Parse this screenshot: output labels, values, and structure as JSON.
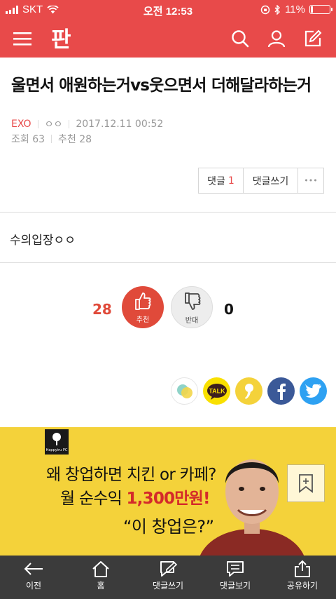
{
  "status": {
    "carrier": "SKT",
    "time": "오전 12:53",
    "battery": "11%"
  },
  "header": {
    "logo_text": "판"
  },
  "post": {
    "title": "울면서 애원하는거vs웃으면서 더해달라하는거",
    "category": "EXO",
    "author": "ㅇㅇ",
    "date": "2017.12.11 00:52",
    "views": "조회 63",
    "recommends": "추천 28",
    "body": "수의입장ㅇㅇ"
  },
  "comment_buttons": {
    "comments_label": "댓글",
    "comments_count": "1",
    "write_label": "댓글쓰기",
    "more_label": "•••"
  },
  "votes": {
    "up_count": "28",
    "up_label": "추천",
    "down_label": "반대",
    "down_count": "0"
  },
  "share": {
    "talk_label": "TALK"
  },
  "ad": {
    "line1": "왜 창업하면 치킨 or 카페?",
    "line2_prefix": "월 순수익 ",
    "line2_highlight": "1,300만원!",
    "line3": "“이 창업은?”",
    "brand": "Happyiru PC"
  },
  "toolbar": {
    "items": [
      {
        "label": "이전",
        "icon": "back-arrow-icon"
      },
      {
        "label": "홈",
        "icon": "home-icon"
      },
      {
        "label": "댓글쓰기",
        "icon": "write-comment-icon"
      },
      {
        "label": "댓글보기",
        "icon": "view-comments-icon"
      },
      {
        "label": "공유하기",
        "icon": "share-icon"
      }
    ]
  },
  "colors": {
    "brand_red": "#e84a4a",
    "ad_yellow": "#f4d23a",
    "toolbar": "#3b3b3b"
  }
}
